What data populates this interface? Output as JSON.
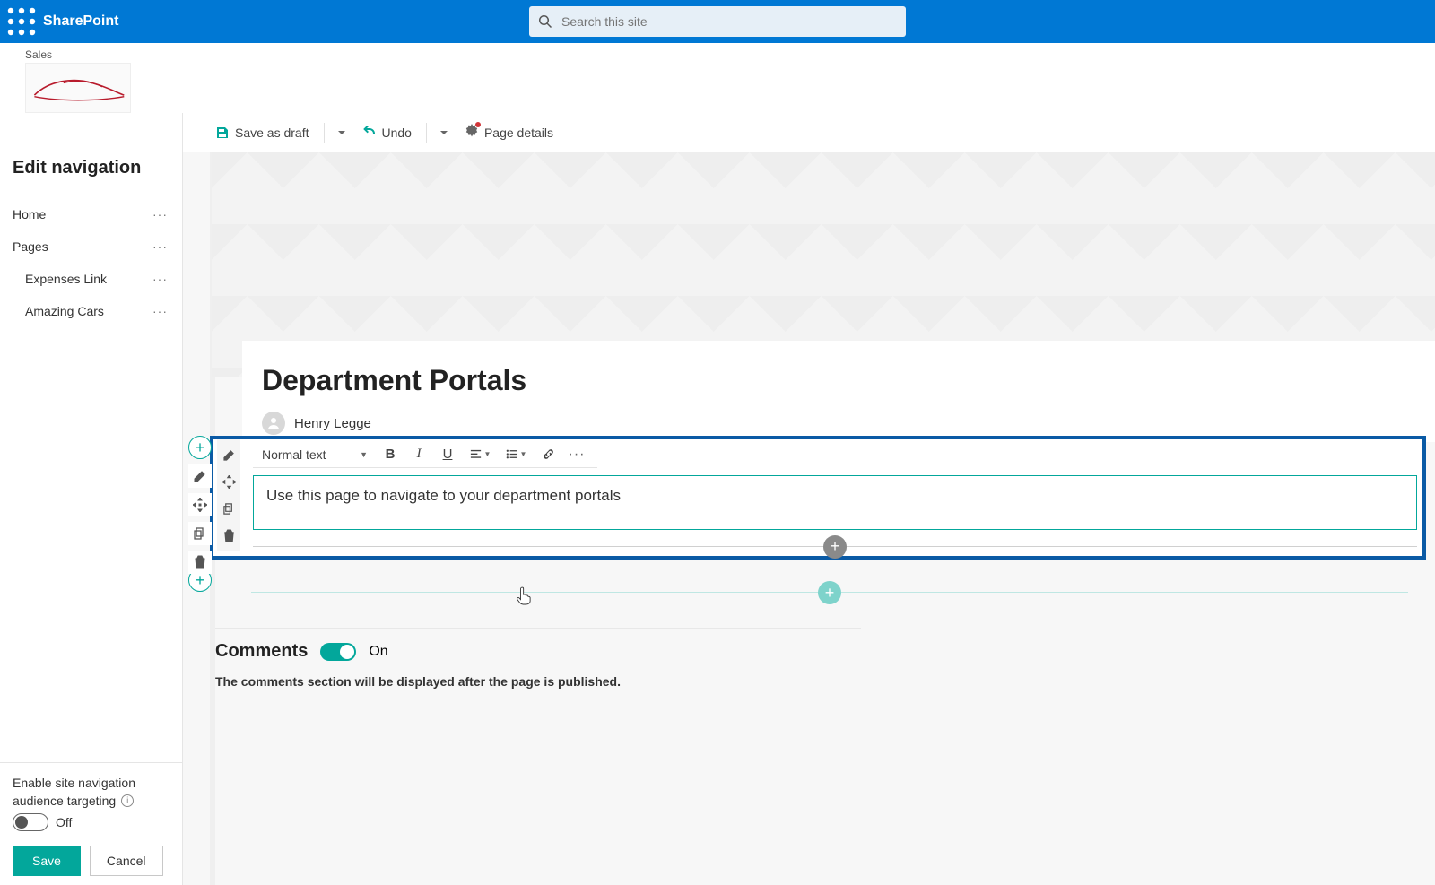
{
  "suite": {
    "brand": "SharePoint",
    "search_placeholder": "Search this site"
  },
  "site": {
    "breadcrumb": "Sales"
  },
  "nav": {
    "title": "Edit navigation",
    "items": [
      {
        "label": "Home",
        "indent": false
      },
      {
        "label": "Pages",
        "indent": false
      },
      {
        "label": "Expenses Link",
        "indent": true
      },
      {
        "label": "Amazing Cars",
        "indent": true
      }
    ],
    "audience_label_line1": "Enable site navigation",
    "audience_label_line2": "audience targeting",
    "audience_state": "Off",
    "save_label": "Save",
    "cancel_label": "Cancel"
  },
  "command_bar": {
    "save_draft": "Save as draft",
    "undo": "Undo",
    "page_details": "Page details"
  },
  "page": {
    "title": "Department Portals",
    "author": "Henry Legge"
  },
  "text_webpart": {
    "style_select": "Normal text",
    "content": "Use this page to navigate to your department portals"
  },
  "comments": {
    "title": "Comments",
    "state": "On",
    "note": "The comments section will be displayed after the page is published."
  }
}
